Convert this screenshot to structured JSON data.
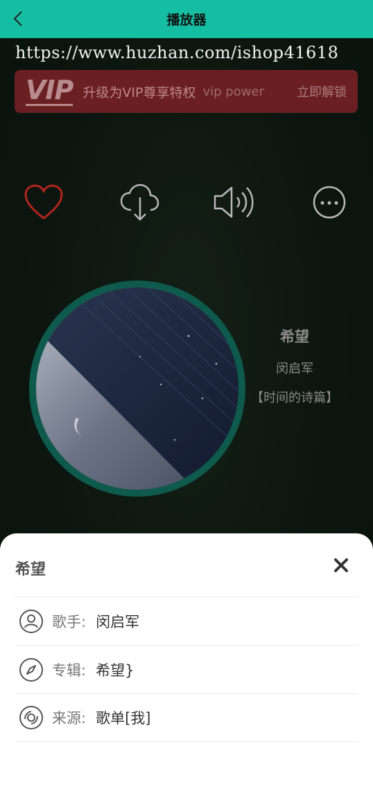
{
  "header": {
    "title": "播放器"
  },
  "watermark": {
    "url": "https://www.huzhan.com/ishop41618"
  },
  "vip": {
    "logo": "VIP",
    "text": "升级为VIP尊享特权",
    "subtext": "vip power",
    "unlock": "立即解锁"
  },
  "actions": [
    {
      "icon": "heart-icon",
      "color": "#b3261e"
    },
    {
      "icon": "cloud-download-icon"
    },
    {
      "icon": "volume-icon"
    },
    {
      "icon": "more-icon"
    }
  ],
  "song": {
    "title": "希望",
    "artist": "闵启军",
    "album": "【时间的诗篇】"
  },
  "sheet": {
    "title": "希望",
    "rows": [
      {
        "icon": "user-icon",
        "label": "歌手:",
        "value": "闵启军"
      },
      {
        "icon": "compass-icon",
        "label": "专辑:",
        "value": "希望}"
      },
      {
        "icon": "disc-icon",
        "label": "来源:",
        "value": "歌单[我]"
      }
    ]
  },
  "colors": {
    "header": "#15bda3",
    "vip_bar": "#6a1f22",
    "disc_ring": "#0e5a4c"
  }
}
